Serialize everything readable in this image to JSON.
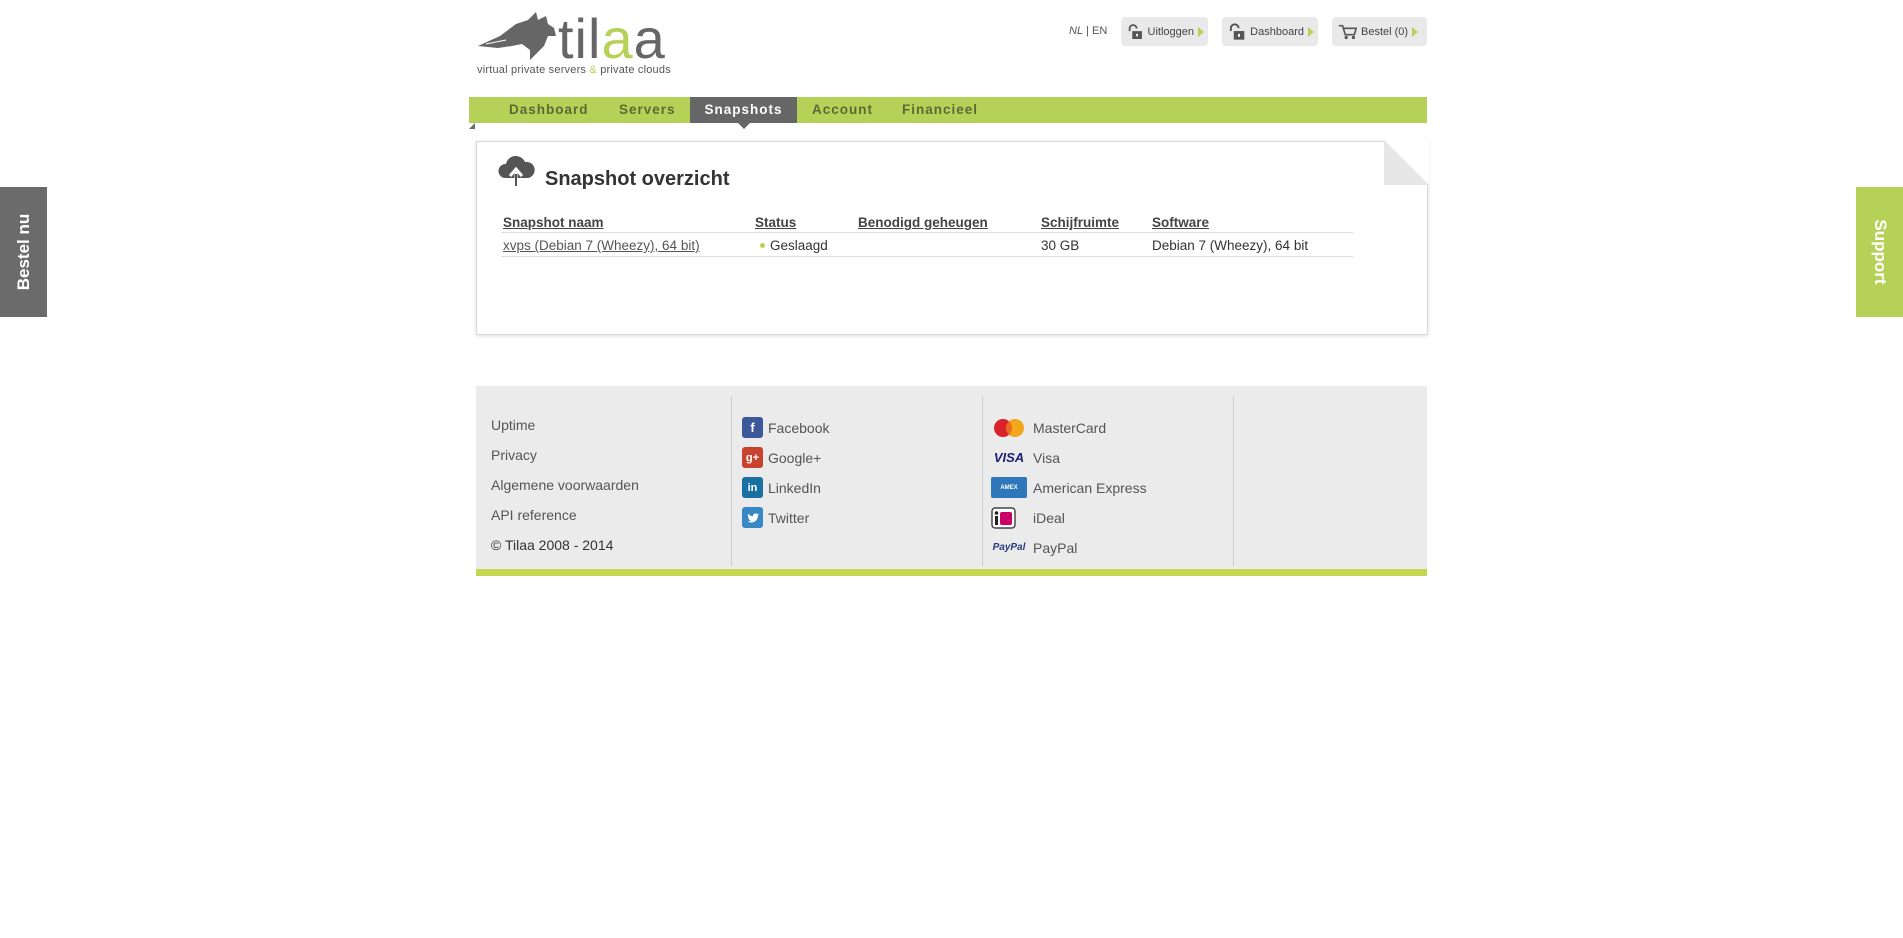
{
  "brand": {
    "name": "tilaa",
    "name_a": "til",
    "name_b": "a",
    "name_c": "a",
    "tagline_a": "virtual private servers",
    "tagline_amp": "&",
    "tagline_b": "private clouds"
  },
  "side": {
    "left_label": "Bestel nu",
    "right_label": "Support"
  },
  "language": {
    "nl": "NL",
    "separator": "|",
    "en": "EN"
  },
  "top_buttons": {
    "logout": "Uitloggen",
    "dashboard": "Dashboard",
    "order": "Bestel (0)"
  },
  "nav": {
    "items": [
      {
        "label": "Dashboard"
      },
      {
        "label": "Servers"
      },
      {
        "label": "Snapshots"
      },
      {
        "label": "Account"
      },
      {
        "label": "Financieel"
      }
    ],
    "active": "Snapshots"
  },
  "panel": {
    "title": "Snapshot overzicht",
    "columns": [
      "Snapshot naam",
      "Status",
      "Benodigd geheugen",
      "Schijfruimte",
      "Software"
    ],
    "rows": [
      {
        "name": "xvps (Debian 7 (Wheezy), 64 bit)",
        "status": "Geslaagd",
        "memory": "",
        "disk": "30 GB",
        "software": "Debian 7 (Wheezy), 64 bit"
      }
    ]
  },
  "footer": {
    "col1": [
      "Uptime",
      "Privacy",
      "Algemene voorwaarden",
      "API reference",
      "© Tilaa 2008 - 2014"
    ],
    "social": [
      "Facebook",
      "Google+",
      "LinkedIn",
      "Twitter"
    ],
    "payments": [
      "MasterCard",
      "Visa",
      "American Express",
      "iDeal",
      "PayPal"
    ]
  },
  "colors": {
    "accent": "#b6d158",
    "dark": "#666666",
    "footer_bar": "#c3d84f"
  }
}
